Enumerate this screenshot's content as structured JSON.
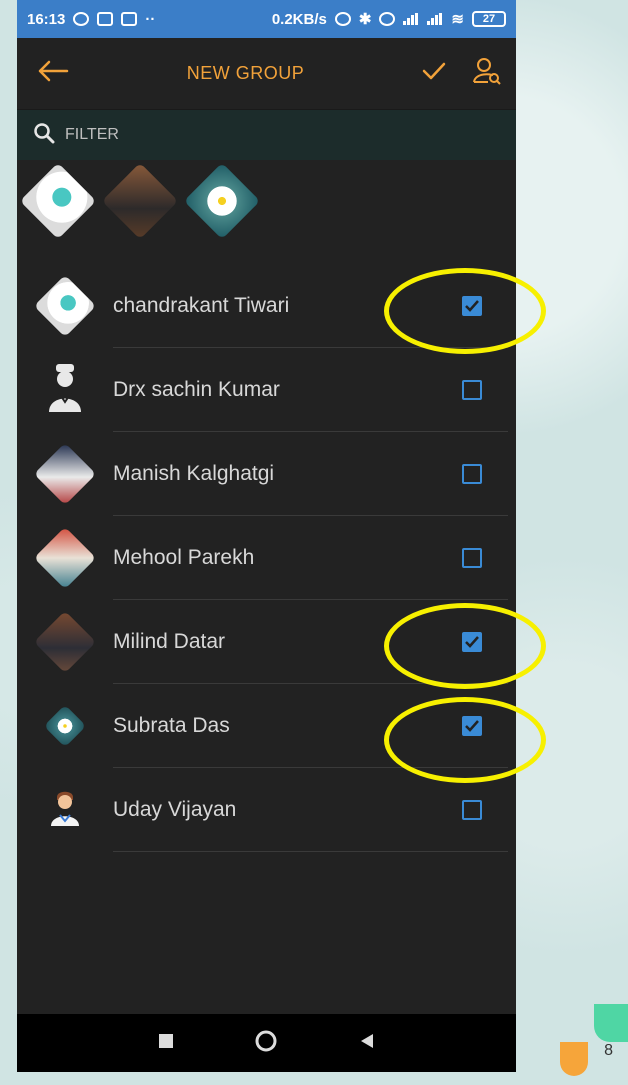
{
  "status_bar": {
    "time": "16:13",
    "network_speed": "0.2KB/s",
    "battery": "27"
  },
  "app_bar": {
    "title": "NEW GROUP",
    "back_icon": "arrow-left-icon",
    "confirm_icon": "check-icon",
    "contacts_icon": "user-search-icon"
  },
  "filter": {
    "placeholder": "FILTER",
    "icon": "search-icon"
  },
  "selected_avatars": [
    {
      "name": "chandrakant Tiwari"
    },
    {
      "name": "Milind Datar"
    },
    {
      "name": "Subrata Das"
    }
  ],
  "contacts": [
    {
      "name": "chandrakant Tiwari",
      "checked": true
    },
    {
      "name": "Drx sachin Kumar",
      "checked": false
    },
    {
      "name": "Manish Kalghatgi",
      "checked": false
    },
    {
      "name": "Mehool Parekh",
      "checked": false
    },
    {
      "name": "Milind Datar",
      "checked": true
    },
    {
      "name": "Subrata Das",
      "checked": true
    },
    {
      "name": "Uday Vijayan",
      "checked": false
    }
  ],
  "slide": {
    "page_number": "8"
  },
  "colors": {
    "accent": "#f2a23a",
    "checkbox": "#3a8bd6",
    "highlight": "#f7f000",
    "status_bar": "#3b7ec8"
  }
}
